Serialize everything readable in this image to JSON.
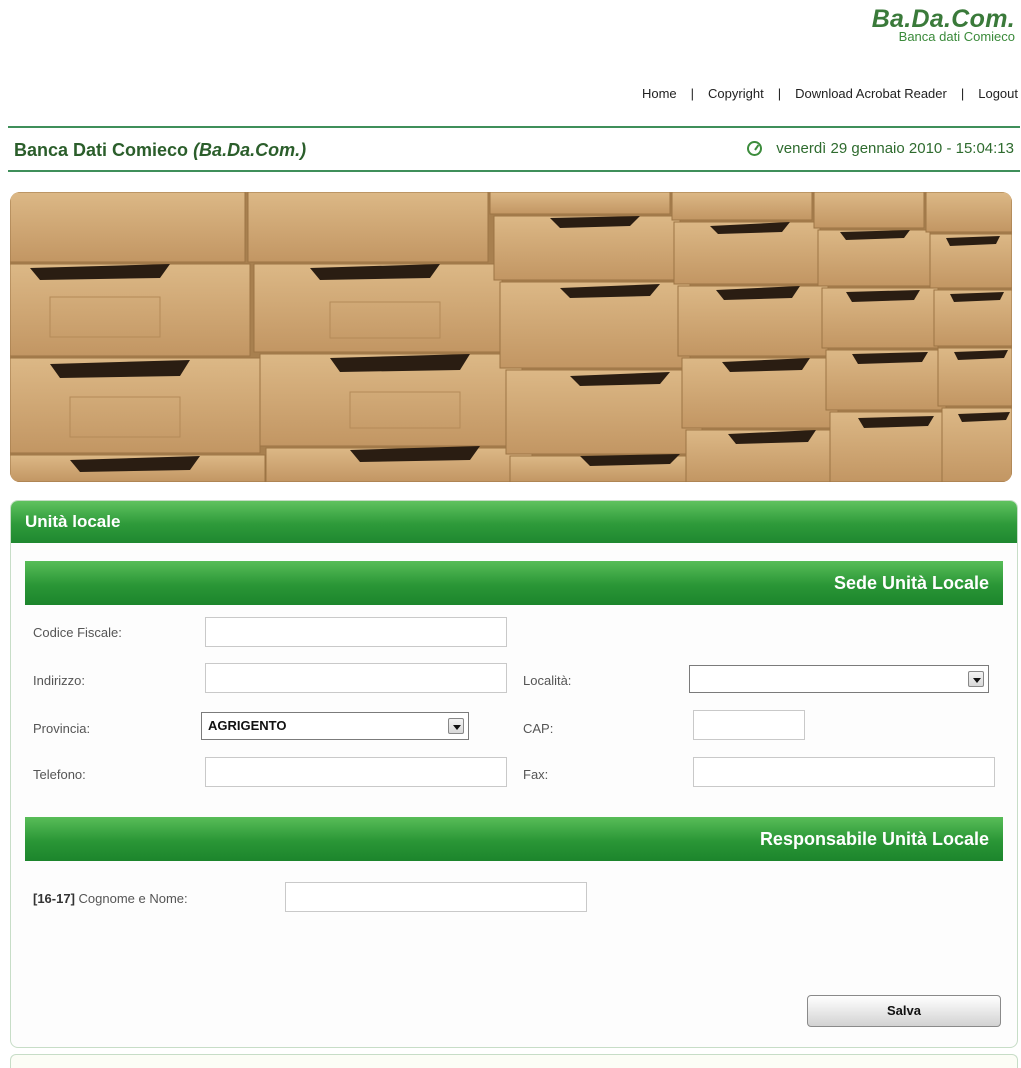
{
  "logo": {
    "title": "Ba.Da.Com.",
    "subtitle": "Banca dati Comieco"
  },
  "nav": {
    "home": "Home",
    "copyright": "Copyright",
    "acrobat": "Download Acrobat Reader",
    "logout": "Logout",
    "separator": "|"
  },
  "header": {
    "title_main": "Banca Dati Comieco ",
    "title_italic": "(Ba.Da.Com.)",
    "datetime": "venerdì 29 gennaio 2010 - 15:04:13"
  },
  "panel": {
    "title": "Unità locale",
    "sede": {
      "section_title": "Sede Unità Locale",
      "codice_fiscale_label": "Codice Fiscale:",
      "codice_fiscale_value": "",
      "indirizzo_label": "Indirizzo:",
      "indirizzo_value": "",
      "localita_label": "Località:",
      "localita_value": "",
      "provincia_label": "Provincia:",
      "provincia_value": "AGRIGENTO",
      "cap_label": "CAP:",
      "cap_value": "",
      "telefono_label": "Telefono:",
      "telefono_value": "",
      "fax_label": "Fax:",
      "fax_value": ""
    },
    "responsabile": {
      "section_title": "Responsabile Unità Locale",
      "code": "[16-17]",
      "nome_label": " Cognome e Nome:",
      "nome_value": ""
    },
    "save_label": "Salva"
  },
  "colors": {
    "accent_green": "#2e9a3a",
    "title_green": "#2b5e2b",
    "banner_tan": "#cfa977"
  }
}
